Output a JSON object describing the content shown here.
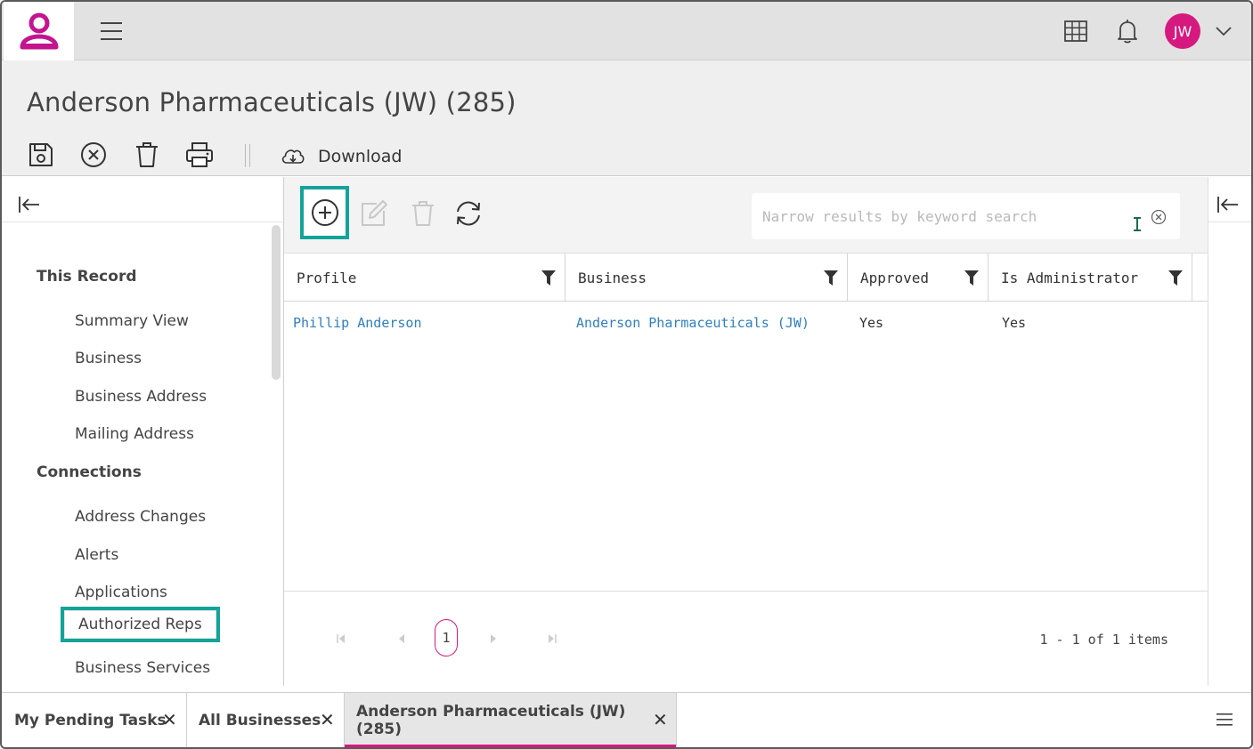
{
  "app": {
    "user_initials": "JW",
    "brand_color": "#d6197e",
    "highlight_color": "#14a39a"
  },
  "topbar": {
    "icons": [
      "hamburger-icon",
      "grid-icon",
      "bell-icon",
      "chevron-down-icon"
    ]
  },
  "record": {
    "title": "Anderson Pharmaceuticals (JW) (285)",
    "toolbar": {
      "icons": [
        "save-icon",
        "cancel-icon",
        "trash-icon",
        "print-icon",
        "cloud-download-icon"
      ],
      "download_label": "Download"
    }
  },
  "sidebar": {
    "sections": [
      {
        "title": "This Record",
        "items": [
          "Summary View",
          "Business",
          "Business Address",
          "Mailing Address"
        ]
      },
      {
        "title": "Connections",
        "items": [
          "Address Changes",
          "Alerts",
          "Applications",
          "Authorized Reps",
          "Business Services"
        ]
      }
    ],
    "selected": "Authorized Reps"
  },
  "grid": {
    "search_placeholder": "Narrow results by keyword search",
    "search_value": "",
    "columns": [
      "Profile",
      "Business",
      "Approved",
      "Is Administrator"
    ],
    "rows": [
      {
        "profile": "Phillip Anderson",
        "business": "Anderson Pharmaceuticals (JW)",
        "approved": "Yes",
        "is_administrator": "Yes"
      }
    ],
    "pager": {
      "current_page": "1",
      "summary": "1 - 1 of 1 items"
    }
  },
  "tabs": [
    {
      "label": "My Pending Tasks",
      "active": false
    },
    {
      "label": "All Businesses",
      "active": false
    },
    {
      "label": "Anderson Pharmaceuticals (JW) (285)",
      "active": true
    }
  ],
  "tab_close_glyph": "✕"
}
